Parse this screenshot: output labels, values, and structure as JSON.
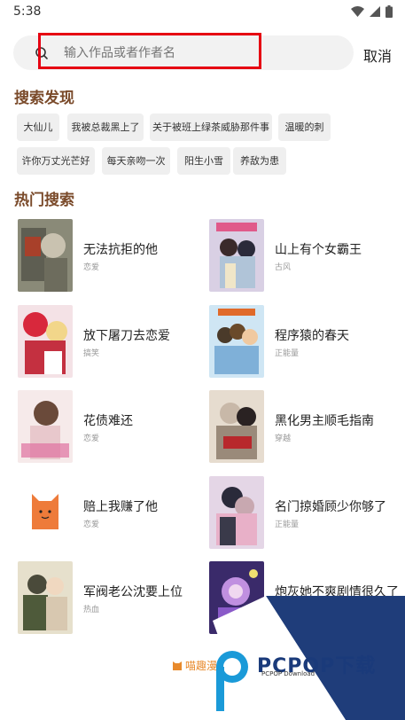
{
  "status": {
    "time": "5:38"
  },
  "search": {
    "placeholder": "输入作品或者作者名",
    "cancel_label": "取消"
  },
  "discover": {
    "title": "搜索发现",
    "tags": [
      "大仙儿",
      "我被总裁黑上了",
      "关于被班上绿茶威胁那件事",
      "温暖的刺",
      "许你万丈光芒好",
      "每天亲吻一次",
      "阳生小雪",
      "养敌为患"
    ]
  },
  "hot": {
    "title": "热门搜索",
    "items": [
      {
        "title": "无法抗拒的他",
        "genre": "恋爱"
      },
      {
        "title": "山上有个女霸王",
        "genre": "古风"
      },
      {
        "title": "放下屠刀去恋爱",
        "genre": "搞笑"
      },
      {
        "title": "程序猿的春天",
        "genre": "正能量"
      },
      {
        "title": "花债难还",
        "genre": "恋爱"
      },
      {
        "title": "黑化男主顺毛指南",
        "genre": "穿越"
      },
      {
        "title": "赔上我赚了他",
        "genre": "恋爱"
      },
      {
        "title": "名门掠婚顾少你够了",
        "genre": "正能量"
      },
      {
        "title": "军阀老公沈要上位",
        "genre": "热血"
      },
      {
        "title": "炮灰她不爽剧情很久了",
        "genre": ""
      }
    ]
  },
  "footer": {
    "brand": "喵趣漫画"
  },
  "watermark": {
    "text": "PCPOP下载",
    "sub": "PCPOP Download"
  },
  "colors": {
    "accent_brown": "#7a4a2a",
    "highlight_red": "#e60012",
    "brand_orange": "#e88a2c",
    "watermark_blue": "#1a3a7a"
  }
}
